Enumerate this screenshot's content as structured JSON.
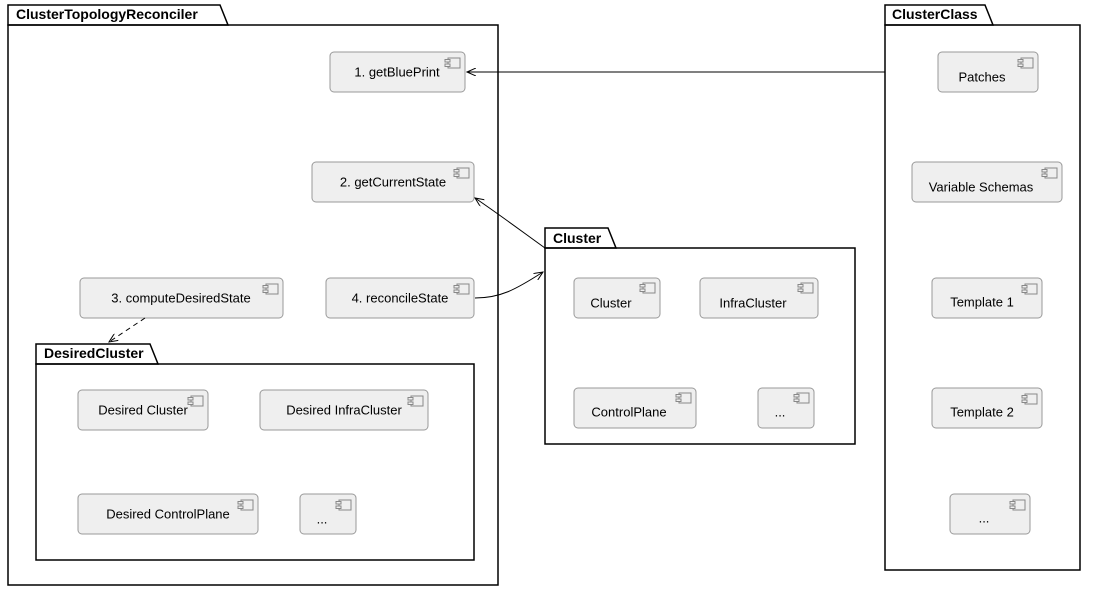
{
  "reconciler": {
    "title": "ClusterTopologyReconciler",
    "step1": "1. getBluePrint",
    "step2": "2. getCurrentState",
    "step3": "3. computeDesiredState",
    "step4": "4. reconcileState"
  },
  "desired_cluster": {
    "title": "DesiredCluster",
    "c1": "Desired Cluster",
    "c2": "Desired InfraCluster",
    "c3": "Desired ControlPlane",
    "c4": "..."
  },
  "cluster": {
    "title": "Cluster",
    "c1": "Cluster",
    "c2": "InfraCluster",
    "c3": "ControlPlane",
    "c4": "..."
  },
  "cluster_class": {
    "title": "ClusterClass",
    "c1": "Patches",
    "c2": "Variable Schemas",
    "c3": "Template 1",
    "c4": "Template 2",
    "c5": "..."
  }
}
